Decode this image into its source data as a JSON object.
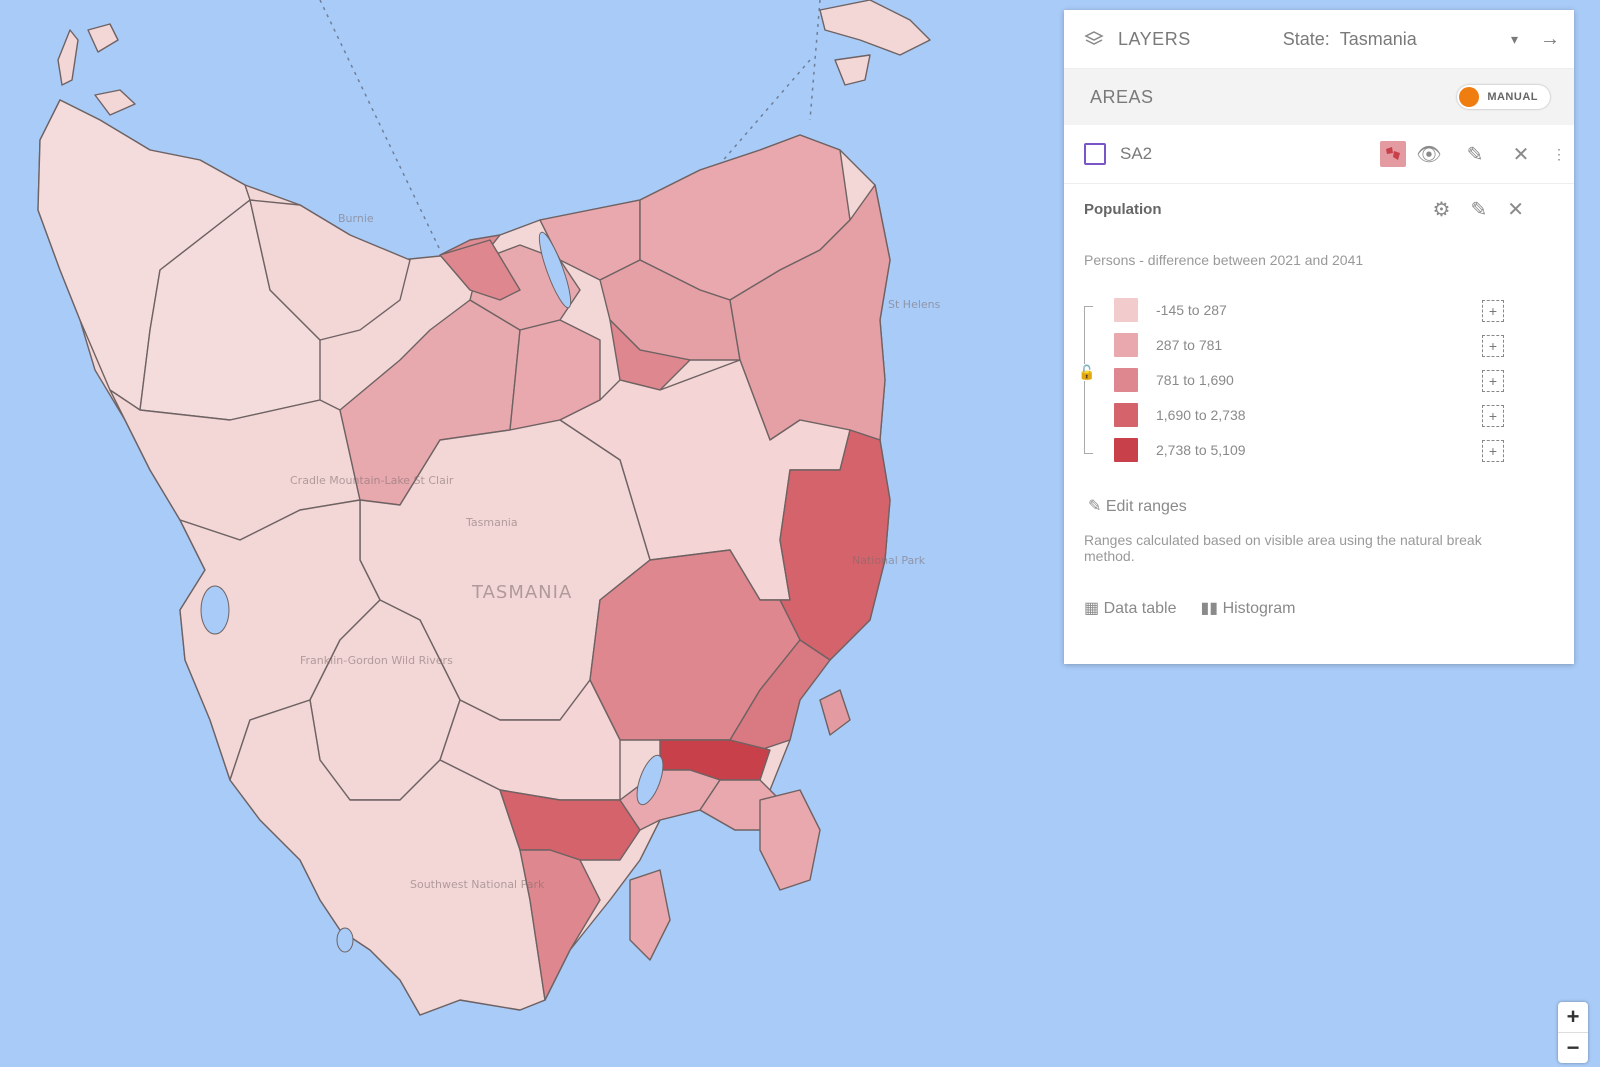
{
  "panel": {
    "layers_label": "LAYERS",
    "state_label": "State:",
    "state_value": "Tasmania",
    "areas_label": "AREAS",
    "mode_label": "MANUAL",
    "layer_name": "SA2",
    "indicator_title": "Population",
    "indicator_subtitle": "Persons - difference between 2021 and 2041",
    "legend": [
      {
        "label": "-145 to 287",
        "color": "#f2cbcd"
      },
      {
        "label": "287 to 781",
        "color": "#e9a8ad"
      },
      {
        "label": "781 to 1,690",
        "color": "#df878e"
      },
      {
        "label": "1,690 to 2,738",
        "color": "#d4636c"
      },
      {
        "label": "2,738 to 5,109",
        "color": "#c8404a"
      }
    ],
    "edit_ranges": "Edit ranges",
    "note": "Ranges calculated based on visible area using the natural break method.",
    "data_table": "Data table",
    "histogram": "Histogram"
  },
  "map_labels": {
    "burnie": "Burnie",
    "st_helens": "St Helens",
    "tasmania": "TASMANIA",
    "tasmania_small": "Tasmania",
    "southwest": "Southwest National Park",
    "freycinet": "National Park",
    "cradle": "Cradle Mountain-Lake St Clair",
    "franklin": "Franklin-Gordon Wild Rivers"
  },
  "zoom": {
    "in": "+",
    "out": "−"
  },
  "colors": {
    "sea": "#a9cbf7",
    "base_region": "#f3d7d7",
    "accent": "#ef7d10"
  }
}
